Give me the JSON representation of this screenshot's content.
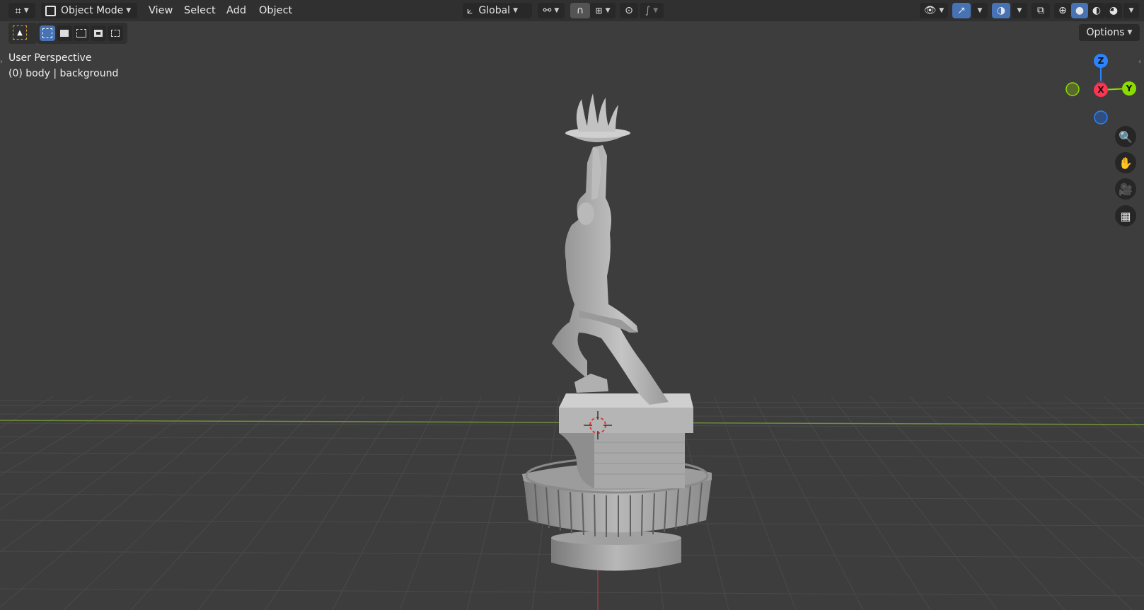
{
  "header": {
    "mode_label": "Object Mode",
    "menus": [
      "View",
      "Select",
      "Add",
      "Object"
    ],
    "orientation_label": "Global"
  },
  "toolbar": {
    "options_label": "Options"
  },
  "viewport": {
    "view_name": "User Perspective",
    "object_info": "(0) body | background"
  },
  "gizmo": {
    "z": "Z",
    "x": "X",
    "y": "Y"
  },
  "colors": {
    "accent_blue": "#4772b3",
    "axis_x": "#ff3352",
    "axis_y": "#8bdc00",
    "axis_z": "#2b83ff"
  }
}
